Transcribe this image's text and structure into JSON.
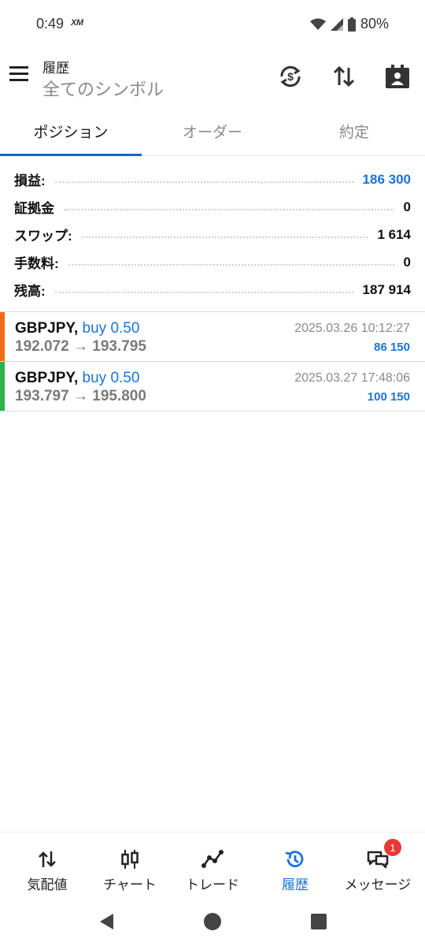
{
  "status_bar": {
    "time": "0:49",
    "logo": "XM",
    "battery": "80%"
  },
  "app_bar": {
    "title": "履歴",
    "subtitle": "全てのシンボル",
    "icons": [
      "menu-icon",
      "currency-exchange-icon",
      "sort-icon",
      "account-icon"
    ]
  },
  "tabs": [
    {
      "label": "ポジション",
      "active": true
    },
    {
      "label": "オーダー",
      "active": false
    },
    {
      "label": "約定",
      "active": false
    }
  ],
  "summary": [
    {
      "label": "損益:",
      "value": "186 300",
      "highlight": true
    },
    {
      "label": "証拠金",
      "value": "0",
      "highlight": false
    },
    {
      "label": "スワップ:",
      "value": "1 614",
      "highlight": false
    },
    {
      "label": "手数料:",
      "value": "0",
      "highlight": false
    },
    {
      "label": "残高:",
      "value": "187 914",
      "highlight": false
    }
  ],
  "positions": [
    {
      "symbol": "GBPJPY,",
      "side": "buy 0.50",
      "open_price": "192.072",
      "close_price": "193.795",
      "arrow": "→",
      "time": "2025.03.26 10:12:27",
      "profit": "86 150",
      "color": "#f26a1b"
    },
    {
      "symbol": "GBPJPY,",
      "side": "buy 0.50",
      "open_price": "193.797",
      "close_price": "195.800",
      "arrow": "→",
      "time": "2025.03.27 17:48:06",
      "profit": "100 150",
      "color": "#2db34a"
    }
  ],
  "bottom_nav": [
    {
      "label": "気配値",
      "icon": "quotes-icon",
      "active": false
    },
    {
      "label": "チャート",
      "icon": "chart-icon",
      "active": false
    },
    {
      "label": "トレード",
      "icon": "trade-icon",
      "active": false
    },
    {
      "label": "履歴",
      "icon": "history-icon",
      "active": true
    },
    {
      "label": "メッセージ",
      "icon": "messages-icon",
      "active": false,
      "badge": "1"
    }
  ],
  "colors": {
    "accent": "#1a73d9",
    "tab_indicator": "#1565c0",
    "badge": "#e53935"
  }
}
